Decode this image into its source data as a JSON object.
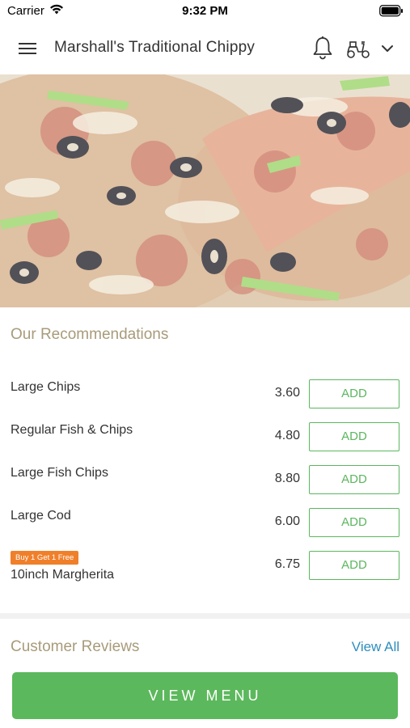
{
  "status_bar": {
    "carrier": "Carrier",
    "time": "9:32 PM"
  },
  "header": {
    "title": "Marshall's Traditional Chippy"
  },
  "recommendations": {
    "title": "Our Recommendations",
    "items": [
      {
        "name": "Large Chips",
        "price": "3.60",
        "button": "ADD"
      },
      {
        "name": "Regular Fish & Chips",
        "price": "4.80",
        "button": "ADD"
      },
      {
        "name": "Large Fish Chips",
        "price": "8.80",
        "button": "ADD"
      },
      {
        "name": "Large Cod",
        "price": "6.00",
        "button": "ADD"
      },
      {
        "name": "10inch Margherita",
        "price": "6.75",
        "button": "ADD",
        "badge": "Buy 1 Get 1 Free"
      }
    ]
  },
  "reviews": {
    "title": "Customer Reviews",
    "view_all": "View All"
  },
  "footer": {
    "view_menu": "VIEW MENU"
  },
  "colors": {
    "accent_green": "#5cb85c",
    "promo_orange": "#f07f2a",
    "link_blue": "#2e8ebd",
    "section_title": "#a89b7a"
  },
  "icons": [
    "menu-icon",
    "bell-icon",
    "scooter-icon",
    "chevron-down-icon",
    "wifi-icon",
    "battery-icon"
  ]
}
